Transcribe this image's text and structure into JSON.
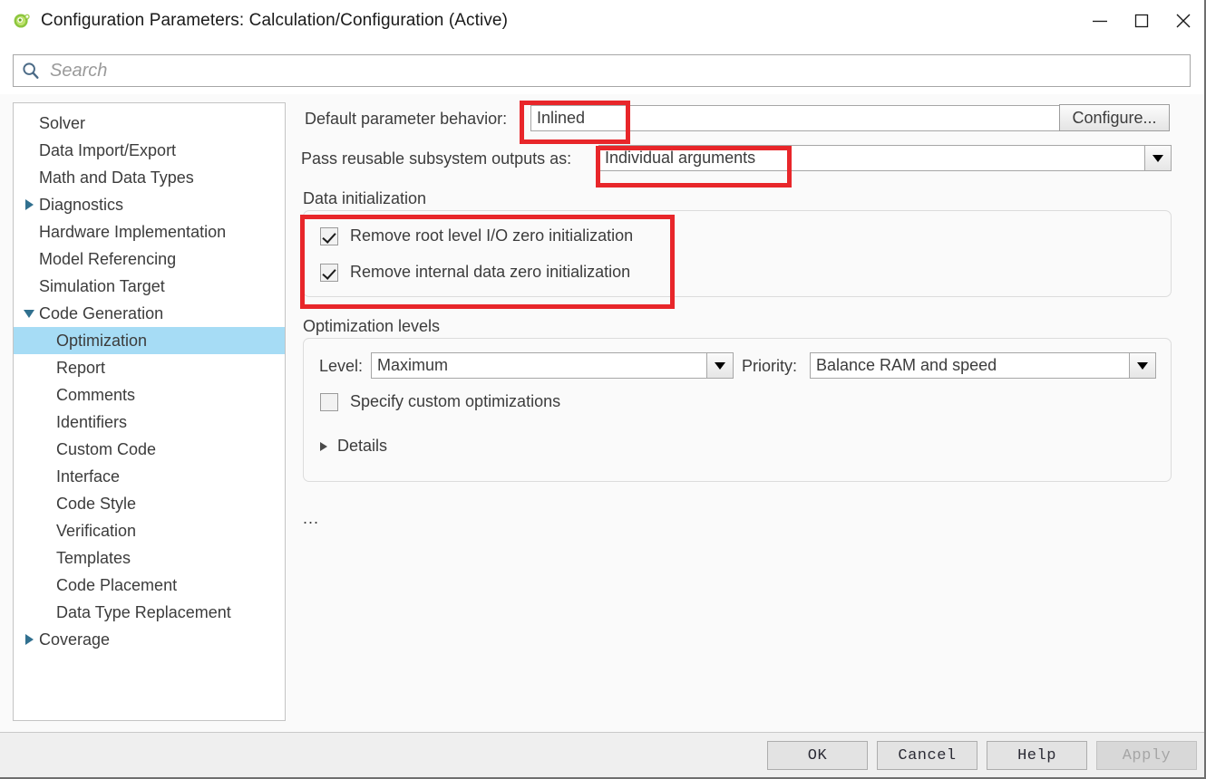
{
  "window": {
    "title": "Configuration Parameters: Calculation/Configuration (Active)",
    "icon": "simulink-gear-icon",
    "minimize_label": "Minimize",
    "maximize_label": "Maximize",
    "close_label": "Close"
  },
  "search": {
    "placeholder": "Search",
    "value": "",
    "icon": "search-icon"
  },
  "sidebar": {
    "items": [
      {
        "label": "Solver",
        "level": 0,
        "arrow": "none",
        "selected": false
      },
      {
        "label": "Data Import/Export",
        "level": 0,
        "arrow": "none",
        "selected": false
      },
      {
        "label": "Math and Data Types",
        "level": 0,
        "arrow": "none",
        "selected": false
      },
      {
        "label": "Diagnostics",
        "level": 0,
        "arrow": "collapsed",
        "selected": false
      },
      {
        "label": "Hardware Implementation",
        "level": 0,
        "arrow": "none",
        "selected": false
      },
      {
        "label": "Model Referencing",
        "level": 0,
        "arrow": "none",
        "selected": false
      },
      {
        "label": "Simulation Target",
        "level": 0,
        "arrow": "none",
        "selected": false
      },
      {
        "label": "Code Generation",
        "level": 0,
        "arrow": "expanded",
        "selected": false
      },
      {
        "label": "Optimization",
        "level": 1,
        "arrow": "none",
        "selected": true
      },
      {
        "label": "Report",
        "level": 1,
        "arrow": "none",
        "selected": false
      },
      {
        "label": "Comments",
        "level": 1,
        "arrow": "none",
        "selected": false
      },
      {
        "label": "Identifiers",
        "level": 1,
        "arrow": "none",
        "selected": false
      },
      {
        "label": "Custom Code",
        "level": 1,
        "arrow": "none",
        "selected": false
      },
      {
        "label": "Interface",
        "level": 1,
        "arrow": "none",
        "selected": false
      },
      {
        "label": "Code Style",
        "level": 1,
        "arrow": "none",
        "selected": false
      },
      {
        "label": "Verification",
        "level": 1,
        "arrow": "none",
        "selected": false
      },
      {
        "label": "Templates",
        "level": 1,
        "arrow": "none",
        "selected": false
      },
      {
        "label": "Code Placement",
        "level": 1,
        "arrow": "none",
        "selected": false
      },
      {
        "label": "Data Type Replacement",
        "level": 1,
        "arrow": "none",
        "selected": false
      },
      {
        "label": "Coverage",
        "level": 0,
        "arrow": "collapsed",
        "selected": false
      }
    ],
    "selected_highlight_color": "#a6dcf5"
  },
  "main": {
    "default_param_behavior": {
      "label": "Default parameter behavior:",
      "value": "Inlined"
    },
    "configure_button": "Configure...",
    "pass_reusable": {
      "label": "Pass reusable subsystem outputs as:",
      "value": "Individual arguments"
    },
    "data_initialization": {
      "title": "Data initialization",
      "checkboxes": [
        {
          "label": "Remove root level I/O zero initialization",
          "checked": true
        },
        {
          "label": "Remove internal data zero initialization",
          "checked": true
        }
      ]
    },
    "optimization_levels": {
      "title": "Optimization levels",
      "level_label": "Level:",
      "level_value": "Maximum",
      "priority_label": "Priority:",
      "priority_value": "Balance RAM and speed",
      "custom_checkbox": {
        "label": "Specify custom optimizations",
        "checked": false
      },
      "details_label": "Details"
    },
    "more_ellipsis": "..."
  },
  "footer": {
    "buttons": [
      {
        "label": "OK",
        "disabled": false
      },
      {
        "label": "Cancel",
        "disabled": false
      },
      {
        "label": "Help",
        "disabled": false
      },
      {
        "label": "Apply",
        "disabled": true
      }
    ]
  },
  "annotations": {
    "color": "#e8262a",
    "boxes": [
      {
        "name": "annotation-default-parameter-behavior"
      },
      {
        "name": "annotation-pass-reusable-subsystem-outputs"
      },
      {
        "name": "annotation-data-initialization-checkboxes"
      }
    ]
  }
}
